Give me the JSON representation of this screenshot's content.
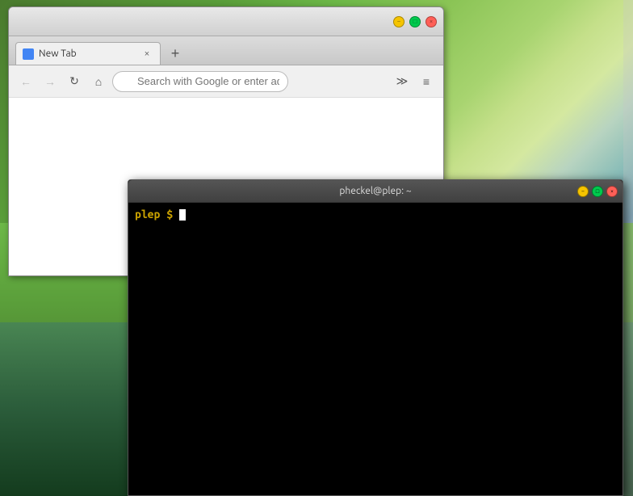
{
  "desktop": {
    "background_desc": "Green landscape with sky"
  },
  "browser": {
    "tab": {
      "title": "New Tab",
      "close_label": "×"
    },
    "new_tab_label": "+",
    "window_controls": {
      "minimize_label": "−",
      "maximize_label": "□",
      "close_label": "×"
    },
    "nav": {
      "back_label": "←",
      "forward_label": "→",
      "reload_label": "↻",
      "home_label": "⌂",
      "address_placeholder": "Search with Google or enter address",
      "extensions_label": "≫",
      "menu_label": "≡"
    }
  },
  "terminal": {
    "title": "pheckel@plep: ~",
    "prompt": "plep $",
    "window_controls": {
      "minimize_label": "−",
      "maximize_label": "□",
      "close_label": "×"
    },
    "cursor_char": " "
  }
}
